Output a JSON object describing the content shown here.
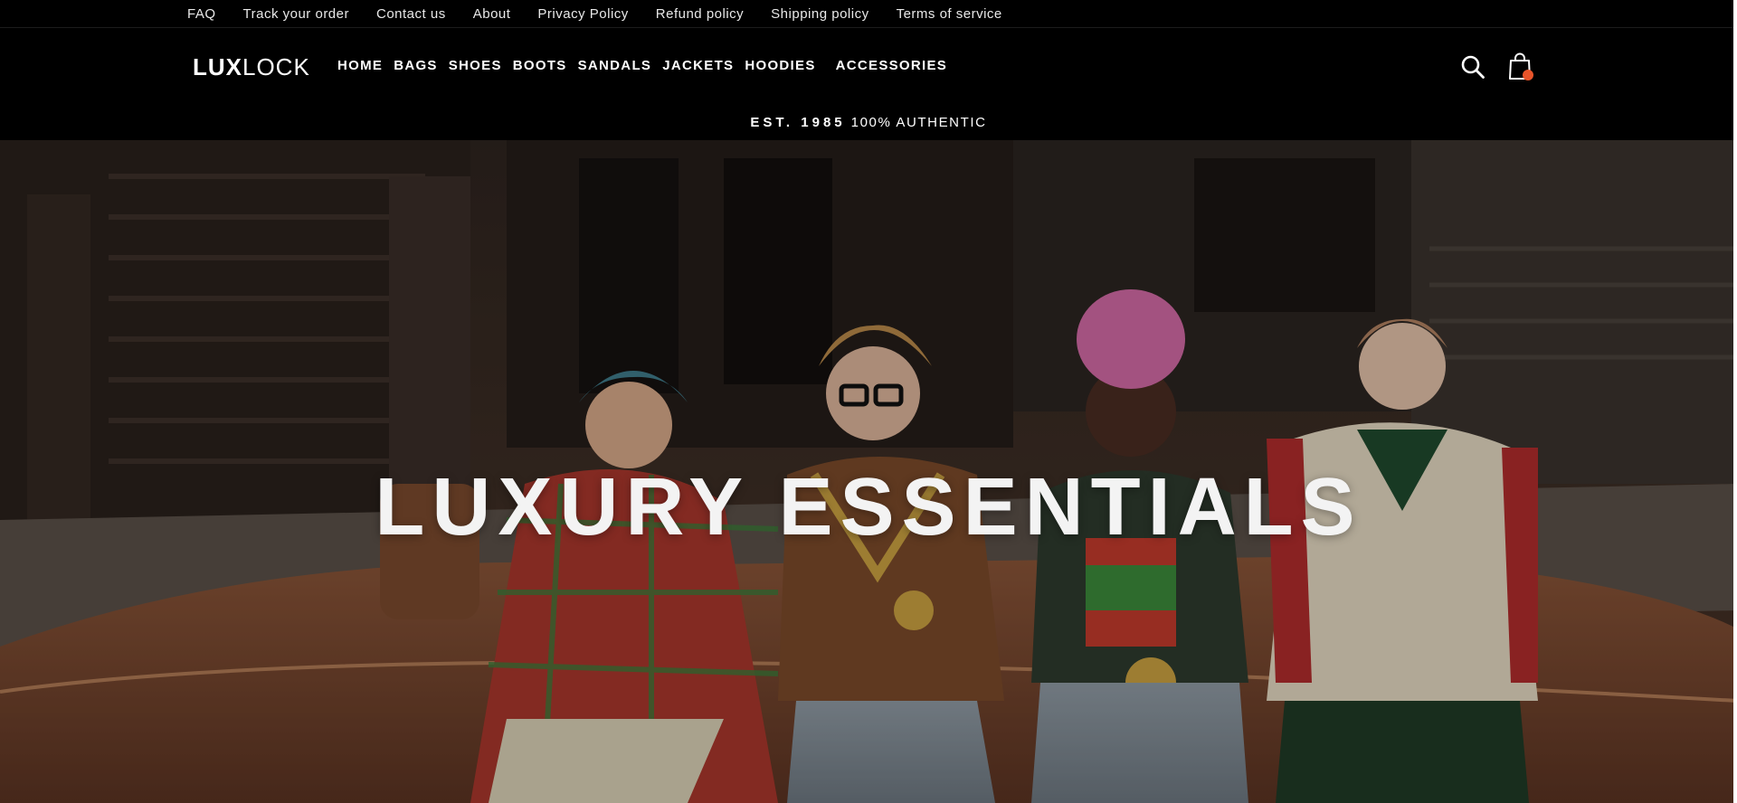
{
  "utility_nav": {
    "links": [
      "FAQ",
      "Track your order",
      "Contact us",
      "About",
      "Privacy Policy",
      "Refund policy",
      "Shipping policy",
      "Terms of service"
    ]
  },
  "header": {
    "logo_lux": "LUX",
    "logo_lock": "LOCK",
    "nav": [
      "HOME",
      "BAGS",
      "SHOES",
      "BOOTS",
      "SANDALS",
      "JACKETS",
      "HOODIES",
      "ACCESSORIES"
    ],
    "icons": {
      "search": "search-icon",
      "cart": "shopping-bag-icon"
    },
    "cart_dot_color": "#e8542a",
    "tagline_est": "EST. 1985",
    "tagline_authentic": "100% AUTHENTIC"
  },
  "hero": {
    "title": "LUXURY ESSENTIALS"
  },
  "colors": {
    "background": "#000000",
    "text": "#ffffff",
    "accent": "#e8542a"
  }
}
